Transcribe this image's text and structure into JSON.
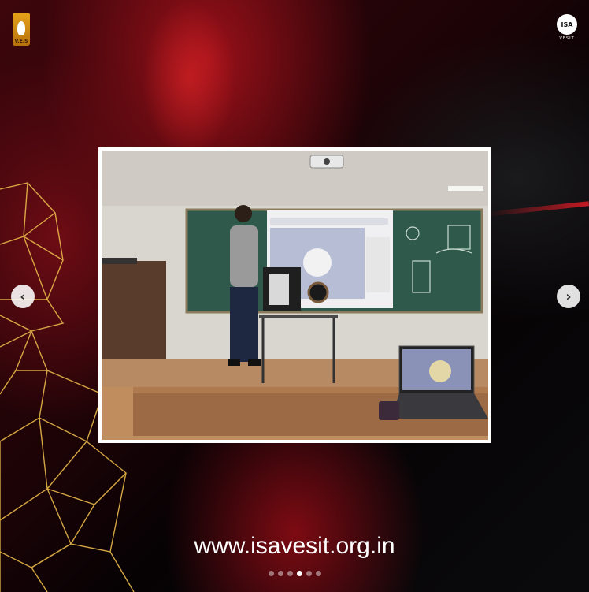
{
  "brand": {
    "left_logo": {
      "icon": "flame-crest-icon",
      "text": "V.E.S",
      "color": "#d98f15"
    },
    "right_logo": {
      "icon": "isa-circle-logo-icon",
      "text": "ISA",
      "subtext": "VESIT"
    }
  },
  "carousel": {
    "prev_icon": "chevron-left-icon",
    "next_icon": "chevron-right-icon",
    "slide_count": 6,
    "active_index": 3
  },
  "footer": {
    "website": "www.isavesit.org.in"
  },
  "colors": {
    "accent_red": "#c51a24",
    "mesh_gold": "#e8b84a",
    "frame": "#ffffff"
  }
}
